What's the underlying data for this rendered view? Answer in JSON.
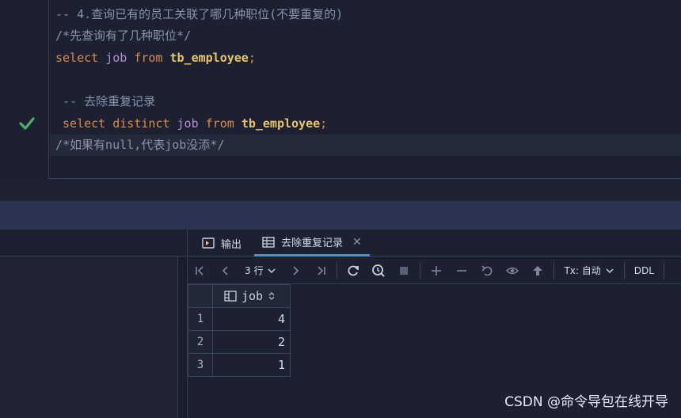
{
  "editor": {
    "lines": [
      {
        "comment": "-- 4.查询已有的员工关联了哪几种职位(不要重复的)"
      },
      {
        "comment": "/*先查询有了几种职位*/"
      },
      {
        "kw1": "select",
        "id": "job",
        "kw2": "from",
        "table": "tb_employee",
        "punct": ";"
      },
      {
        "comment": " -- 去除重复记录"
      },
      {
        "kw1": "select",
        "kw_distinct": "distinct",
        "id": "job",
        "kw2": "from",
        "table": "tb_employee",
        "punct": ";"
      },
      {
        "comment": "/*如果有null,代表job没添*/"
      }
    ],
    "status_icon": "check-icon"
  },
  "tabs": [
    {
      "label": "输出",
      "icon": "output-icon"
    },
    {
      "label": "去除重复记录",
      "icon": "table-icon",
      "close": "✕"
    }
  ],
  "toolbar": {
    "row_count": "3 行",
    "tx_label": "Tx: 自动",
    "ddl_label": "DDL"
  },
  "grid": {
    "column": "job",
    "rows": [
      {
        "num": "1",
        "job": "4"
      },
      {
        "num": "2",
        "job": "2"
      },
      {
        "num": "3",
        "job": "1"
      }
    ]
  },
  "watermark": "CSDN @命令导包在线开导",
  "colors": {
    "accent": "#4c8bf5",
    "check": "#4caf6a",
    "keyword": "#d98c4f",
    "identifier": "#b38fd1",
    "table": "#e8c46a"
  }
}
